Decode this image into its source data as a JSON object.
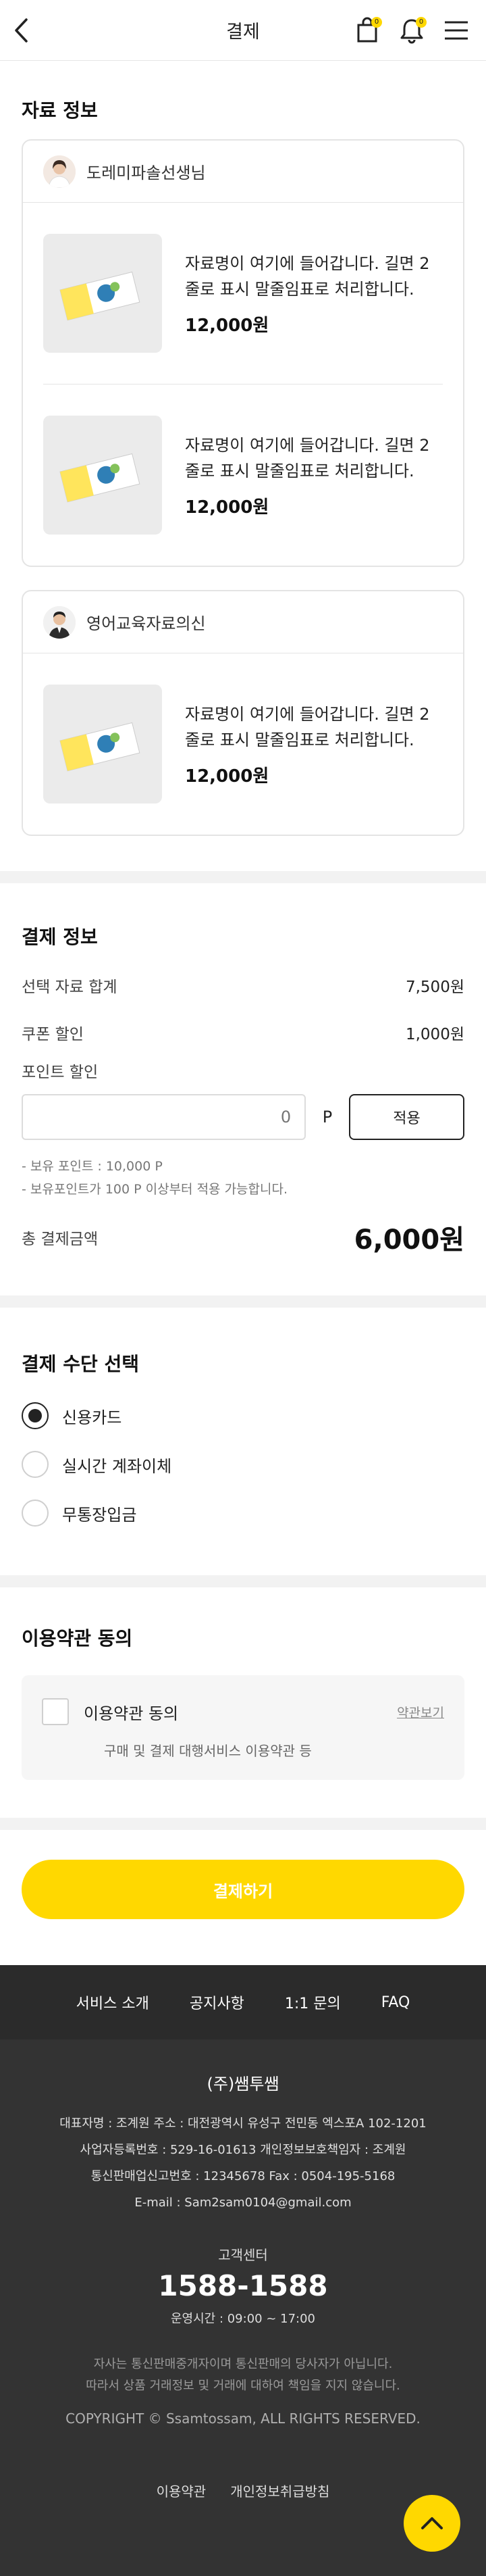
{
  "header": {
    "title": "결제",
    "cart_badge": "0",
    "bell_badge": "0"
  },
  "materials": {
    "title": "자료 정보",
    "sellers": [
      {
        "name": "도레미파솔선생님",
        "items": [
          {
            "name": "자료명이 여기에 들어갑니다. 길면 2줄로 표시 말줄임표로 처리합니다.",
            "price": "12,000원"
          },
          {
            "name": "자료명이 여기에 들어갑니다. 길면 2줄로 표시 말줄임표로 처리합니다.",
            "price": "12,000원"
          }
        ]
      },
      {
        "name": "영어교육자료의신",
        "items": [
          {
            "name": "자료명이 여기에 들어갑니다. 길면 2줄로 표시 말줄임표로 처리합니다.",
            "price": "12,000원"
          }
        ]
      }
    ]
  },
  "payment": {
    "title": "결제 정보",
    "subtotal_label": "선택 자료 합계",
    "subtotal": "7,500원",
    "coupon_label": "쿠폰 할인",
    "coupon": "1,000원",
    "point_label": "포인트 할인",
    "point_value": "0",
    "point_unit": "P",
    "apply_label": "적용",
    "note1": "- 보유 포인트 : 10,000 P",
    "note2": "- 보유포인트가 100 P 이상부터 적용 가능합니다.",
    "total_label": "총 결제금액",
    "total": "6,000원"
  },
  "method": {
    "title": "결제 수단 선택",
    "options": [
      "신용카드",
      "실시간 계좌이체",
      "무통장입금"
    ],
    "selected": "신용카드"
  },
  "terms": {
    "title": "이용약관 동의",
    "label": "이용약관 동의",
    "link": "약관보기",
    "desc": "구매 및 결제 대행서비스 이용약관 등"
  },
  "pay_button": "결제하기",
  "footer": {
    "nav": [
      "서비스 소개",
      "공지사항",
      "1:1 문의",
      "FAQ"
    ],
    "company": "(주)쌤투쌤",
    "line1": "대표자명 : 조계원    주소 : 대전광역시 유성구 전민동 엑스포A 102-1201",
    "line2": "사업자등록번호 : 529-16-01613    개인정보보호책임자 : 조계원",
    "line3": "통신판매업신고번호 : 12345678    Fax : 0504-195-5168",
    "line4": "E-mail : Sam2sam0104@gmail.com",
    "cs_label": "고객센터",
    "cs_phone": "1588-1588",
    "cs_hours": "운영시간 : 09:00 ~ 17:00",
    "disclaimer1": "자사는 통신판매중개자이며 통신판매의 당사자가 아닙니다.",
    "disclaimer2": "따라서 상품 거래정보 및 거래에 대하여 책임을 지지 않습니다.",
    "copyright": "COPYRIGHT © Ssamtossam, ALL RIGHTS RESERVED.",
    "links": [
      "이용약관",
      "개인정보취급방침"
    ]
  },
  "colors": {
    "accent": "#ffd800",
    "footer_bg": "#333333",
    "footer_nav_bg": "#2b2b2b"
  },
  "icons": [
    "back-icon",
    "cart-icon",
    "bell-icon",
    "menu-icon",
    "arrow-up-icon"
  ]
}
